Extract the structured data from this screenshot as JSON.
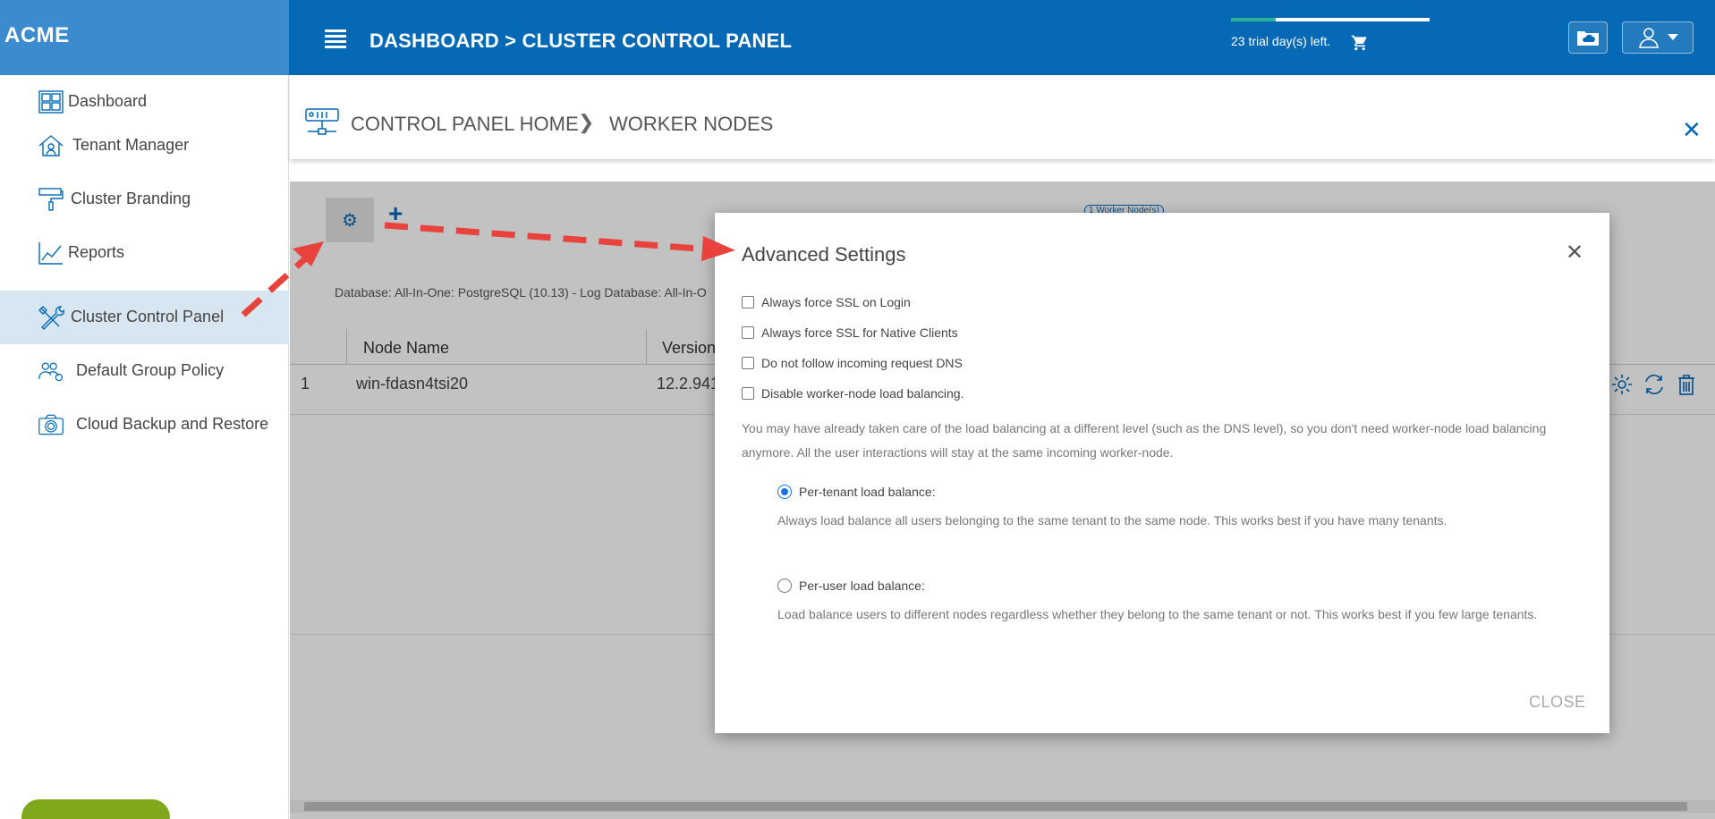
{
  "brand": {
    "logo_text": "ACME"
  },
  "header": {
    "breadcrumb": "DASHBOARD > CLUSTER CONTROL PANEL",
    "trial_text": "23 trial day(s) left.",
    "trial_progress": 0.23
  },
  "sidebar": {
    "items": [
      {
        "label": "Dashboard",
        "icon": "dashboard-grid-icon"
      },
      {
        "label": "Tenant Manager",
        "icon": "tenant-house-icon"
      },
      {
        "label": "Cluster Branding",
        "icon": "paint-roller-icon"
      },
      {
        "label": "Reports",
        "icon": "chart-line-icon"
      },
      {
        "label": "Cluster Control Panel",
        "icon": "tools-icon",
        "active": true
      },
      {
        "label": "Default Group Policy",
        "icon": "group-policy-icon"
      },
      {
        "label": "Cloud Backup and Restore",
        "icon": "camera-icon"
      }
    ]
  },
  "page_header": {
    "home_link": "CONTROL PANEL HOME",
    "current": "WORKER NODES"
  },
  "content": {
    "nodes_badge": "1 Worker Node(s)",
    "db_info": "Database: All-In-One: PostgreSQL (10.13) - Log Database: All-In-O",
    "table": {
      "columns": [
        "Node Name",
        "Version"
      ],
      "rows": [
        {
          "index": "1",
          "node_name": "win-fdasn4tsi20",
          "version": "12.2.941"
        }
      ]
    }
  },
  "modal": {
    "title": "Advanced Settings",
    "checkboxes": [
      "Always force SSL on Login",
      "Always force SSL for Native Clients",
      "Do not follow incoming request DNS",
      "Disable worker-node load balancing."
    ],
    "description": "You may have already taken care of the load balancing at a different level (such as the DNS level), so you don't need worker-node load balancing anymore. All the user interactions will stay at the same incoming worker-node.",
    "radios": [
      {
        "label": "Per-tenant load balance:",
        "desc": "Always load balance all users belonging to the same tenant to the same node. This works best if you have many tenants.",
        "selected": true
      },
      {
        "label": "Per-user load balance:",
        "desc": "Load balance users to different nodes regardless whether they belong to the same tenant or not. This works best if you few large tenants.",
        "selected": false
      }
    ],
    "close_label": "CLOSE"
  },
  "colors": {
    "header_blue": "#0569b5",
    "logo_blue": "#3c8bcf",
    "active_item": "#d8e6f2",
    "help_green": "#7fa81d",
    "annotation_red": "#e8423c"
  }
}
